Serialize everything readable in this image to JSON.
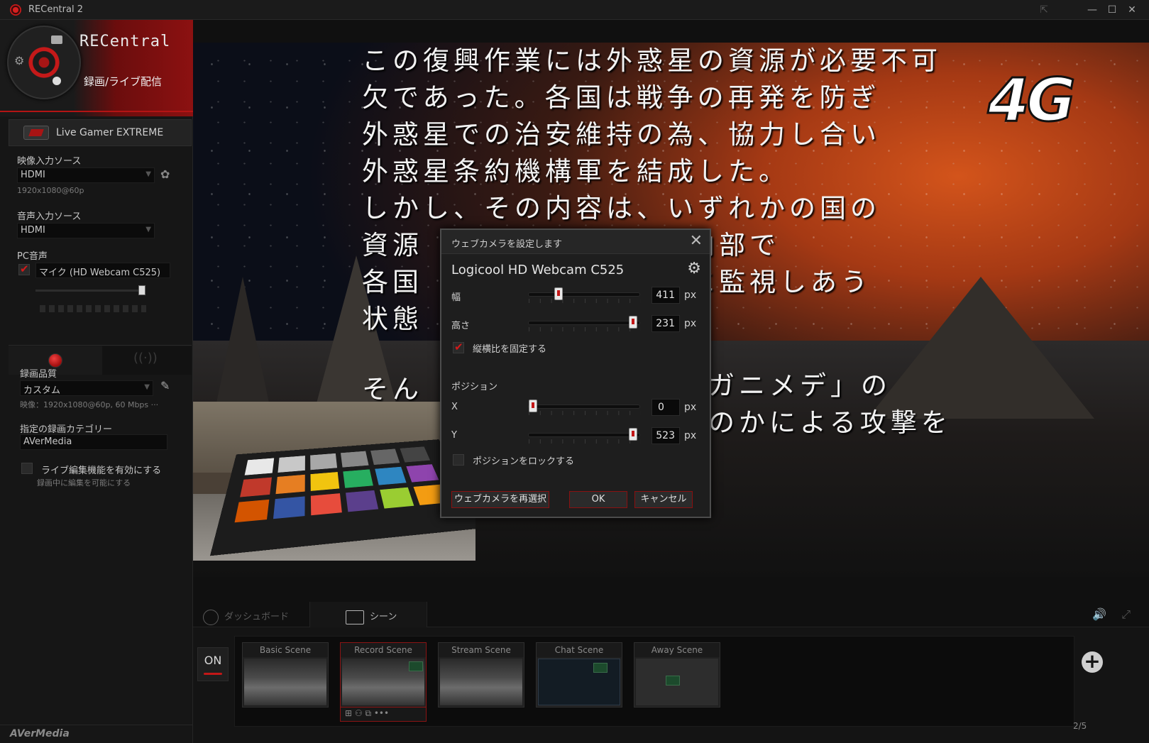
{
  "window": {
    "title": "RECentral 2",
    "controls": [
      "⇱",
      "—",
      "☐",
      "✕"
    ]
  },
  "sidebar": {
    "brand": "RECentral",
    "mode_label": "録画/ライブ配信",
    "device_name": "Live Gamer EXTREME",
    "video_source": {
      "label": "映像入力ソース",
      "value": "HDMI",
      "resolution": "1920x1080@60p"
    },
    "audio_source": {
      "label": "音声入力ソース",
      "value": "HDMI"
    },
    "pc_audio": {
      "label": "PC音声",
      "mic_checked": true,
      "mic_value": "マイク (HD Webcam C525)",
      "volume": 0.95
    },
    "rec_quality": {
      "label": "録画品質",
      "value": "カスタム",
      "detail": "映像：1920x1080@60p, 60 Mbps ···"
    },
    "rec_folder": {
      "label": "指定の録画カテゴリー",
      "value": "AVerMedia"
    },
    "live_edit": {
      "checked": false,
      "label": "ライブ編集機能を有効にする",
      "sub": "録画中に編集を可能にする"
    },
    "footer_logo": "AVerMedia"
  },
  "preview": {
    "game_lines": [
      "この復興作業には外惑星の資源が必要不可",
      "欠であった。各国は戦争の再発を防ぎ",
      "外惑星での治安維持の為、協力し合い",
      "外惑星条約機構軍を結成した。",
      "しかし、その内容は、いずれかの国の",
      "資源",
      "各国",
      "状態"
    ],
    "game_lines_right": [
      "内部で",
      "に監視しあう"
    ],
    "game_line_bottom_left": "そん",
    "game_lines_bottom_right": [
      "ガニメデ」の",
      "のかによる攻撃を"
    ],
    "badge": "4G"
  },
  "dialog": {
    "title": "ウェブカメラを設定します",
    "device": "Logicool HD Webcam C525",
    "width": {
      "label": "幅",
      "value": "411",
      "unit": "px",
      "slider": 0.25
    },
    "height": {
      "label": "高さ",
      "value": "231",
      "unit": "px",
      "slider": 0.98
    },
    "keep_ratio": {
      "label": "縦横比を固定する",
      "checked": true
    },
    "position_label": "ポジション",
    "x": {
      "label": "X",
      "value": "0",
      "unit": "px",
      "slider": 0.0
    },
    "y": {
      "label": "Y",
      "value": "523",
      "unit": "px",
      "slider": 0.98
    },
    "lock_position": {
      "label": "ポジションをロックする",
      "checked": false
    },
    "buttons": {
      "reselect": "ウェブカメラを再選択",
      "ok": "OK",
      "cancel": "キャンセル"
    }
  },
  "bottom": {
    "tabs": {
      "dashboard": "ダッシュボード",
      "scene": "シーン"
    },
    "on_toggle": "ON",
    "scenes": [
      "Basic Scene",
      "Record Scene",
      "Stream Scene",
      "Chat Scene",
      "Away Scene"
    ],
    "selected_scene": "Record Scene",
    "scene_tools": "⊞ ⚇ ⧉ •••",
    "page": "2/5",
    "add_symbol": "+"
  },
  "colors": {
    "accent": "#c41717",
    "panel": "#161616",
    "dialog": "#1e1e1e"
  }
}
